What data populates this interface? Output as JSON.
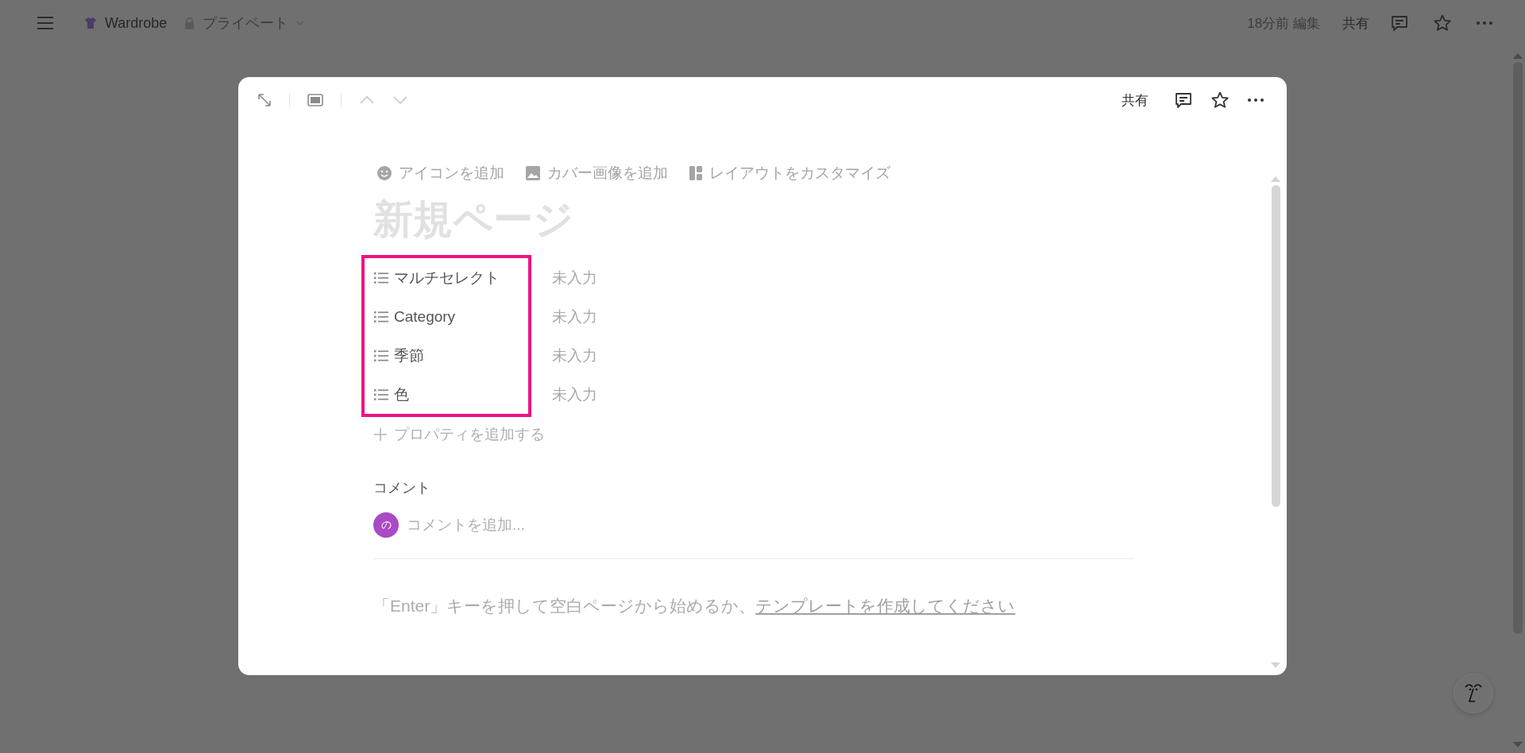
{
  "top_bar": {
    "workspace": "Wardrobe",
    "privacy": "プライベート",
    "edited": "18分前 編集",
    "share": "共有"
  },
  "modal": {
    "share": "共有",
    "page_actions": [
      {
        "label": "アイコンを追加",
        "kind": "emoji"
      },
      {
        "label": "カバー画像を追加",
        "kind": "image"
      },
      {
        "label": "レイアウトをカスタマイズ",
        "kind": "layout"
      }
    ],
    "title_placeholder": "新規ページ",
    "properties": [
      {
        "name": "マルチセレクト",
        "value": "未入力"
      },
      {
        "name": "Category",
        "value": "未入力"
      },
      {
        "name": "季節",
        "value": "未入力"
      },
      {
        "name": "色",
        "value": "未入力"
      }
    ],
    "add_property": "プロパティを追加する",
    "comments": {
      "heading": "コメント",
      "avatar": "の",
      "placeholder": "コメントを追加..."
    },
    "hint": {
      "text": "「Enter」キーを押して空白ページから始めるか、",
      "link": "テンプレートを作成してください"
    }
  }
}
